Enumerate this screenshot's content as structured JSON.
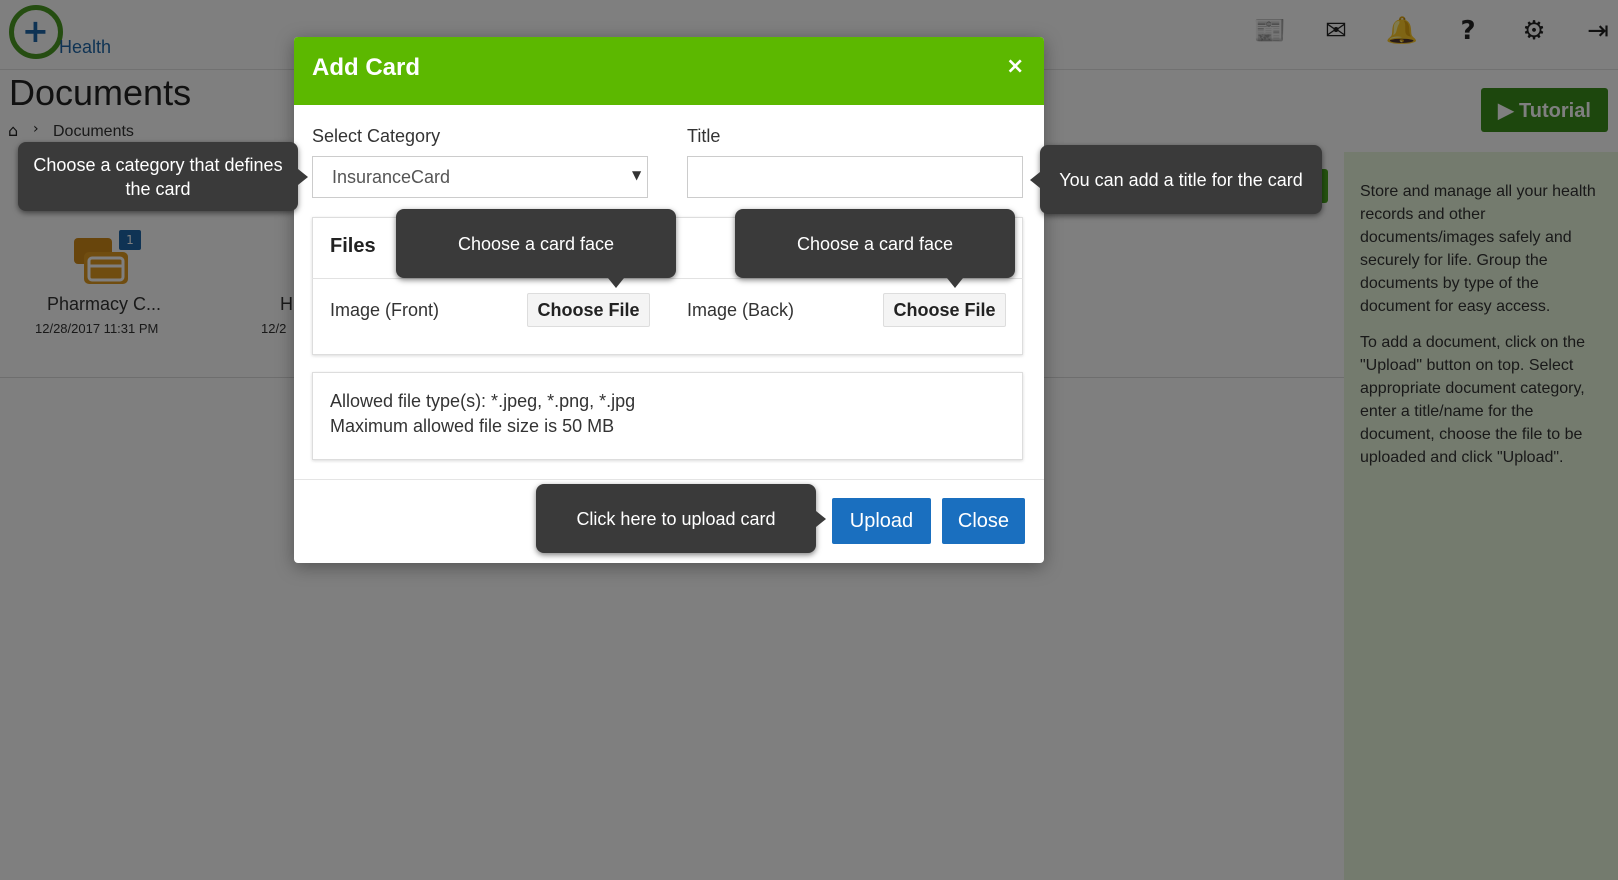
{
  "brand": {
    "logo_text": "Health",
    "logo_symbol": "+"
  },
  "header_icons": [
    {
      "name": "newspaper-icon",
      "glyph": "📰"
    },
    {
      "name": "envelope-icon",
      "glyph": "✉"
    },
    {
      "name": "bell-icon",
      "glyph": "🔔"
    },
    {
      "name": "help-icon",
      "glyph": "?"
    },
    {
      "name": "gear-icon",
      "glyph": "⚙"
    },
    {
      "name": "sign-out-icon",
      "glyph": "⇥"
    }
  ],
  "page": {
    "title": "Documents",
    "breadcrumb": {
      "home_icon": "⌂",
      "separator": "›",
      "current": "Documents"
    },
    "tutorial_label": "▶ Tutorial"
  },
  "help": {
    "paragraph1": "Store and manage all your health records and other documents/images safely and securely for life. Group the documents by type of the document for easy access.",
    "paragraph2": "To add a document, click on the \"Upload\" button on top. Select appropriate document category, enter a title/name for the document, choose the file to be uploaded and click \"Upload\"."
  },
  "documents": [
    {
      "name": "Pharmacy C...",
      "date": "12/28/2017 11:31 PM",
      "badge": "1"
    },
    {
      "name": "H",
      "date": "12/2"
    }
  ],
  "modal": {
    "title": "Add Card",
    "close_glyph": "×",
    "category_label": "Select Category",
    "category_value": "InsuranceCard",
    "title_label": "Title",
    "title_value": "",
    "files_heading": "Files",
    "front_label": "Image (Front)",
    "back_label": "Image (Back)",
    "choose_file_label": "Choose File",
    "allowed_types": "Allowed file type(s): *.jpeg, *.png, *.jpg",
    "max_size": "Maximum allowed file size is 50 MB",
    "upload_label": "Upload",
    "close_label": "Close"
  },
  "tooltips": {
    "category": "Choose a category that defines the card",
    "title": "You can add a title for the card",
    "front": "Choose a card face",
    "back": "Choose a card face",
    "upload": "Click here to upload card"
  },
  "colors": {
    "modal_header": "#5cb800",
    "primary_button": "#1a6fbf",
    "tooltip_bg": "#3a3a3a",
    "help_bg": "#e9f6dc",
    "tutorial_btn": "#3b8f1a"
  }
}
